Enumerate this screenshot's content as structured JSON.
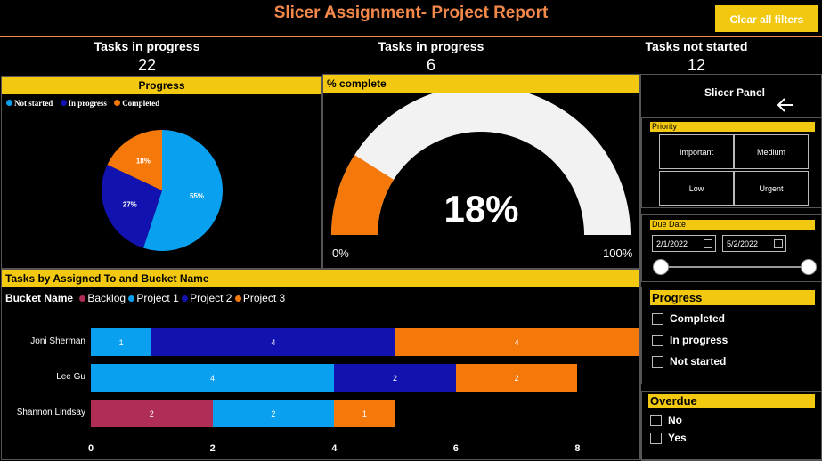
{
  "header": {
    "title": "Slicer Assignment- Project Report",
    "clear_button": "Clear all filters"
  },
  "kpis": [
    {
      "label": "Tasks in progress",
      "value": "22"
    },
    {
      "label": "Tasks in progress",
      "value": "6"
    },
    {
      "label": "Tasks not started",
      "value": "12"
    }
  ],
  "progress_panel": {
    "title": "Progress",
    "legend": [
      {
        "label": "Not started",
        "color": "#0aa0f0"
      },
      {
        "label": "In progress",
        "color": "#1212b0"
      },
      {
        "label": "Completed",
        "color": "#f5780a"
      }
    ]
  },
  "gauge_panel": {
    "title": "% complete",
    "value_label": "18%",
    "min_label": "0%",
    "max_label": "100%"
  },
  "bar_panel": {
    "title": "Tasks by Assigned To and Bucket Name",
    "legend_title": "Bucket Name",
    "legend": [
      {
        "label": "Backlog",
        "color": "#b02d55"
      },
      {
        "label": "Project 1",
        "color": "#0aa0f0"
      },
      {
        "label": "Project 2",
        "color": "#1212b0"
      },
      {
        "label": "Project 3",
        "color": "#f5780a"
      }
    ]
  },
  "slicer_panel": {
    "title": "Slicer Panel",
    "priority": {
      "title": "Priority",
      "options": [
        "Important",
        "Medium",
        "Low",
        "Urgent"
      ]
    },
    "due_date": {
      "title": "Due Date",
      "start": "2/1/2022",
      "end": "5/2/2022"
    },
    "progress": {
      "title": "Progress",
      "options": [
        "Completed",
        "In progress",
        "Not started"
      ]
    },
    "overdue": {
      "title": "Overdue",
      "options": [
        "No",
        "Yes"
      ]
    }
  },
  "chart_data": [
    {
      "type": "pie",
      "title": "Progress",
      "categories": [
        "Not started",
        "In progress",
        "Completed"
      ],
      "values": [
        55,
        27,
        18
      ],
      "labels": [
        "55%",
        "27%",
        "18%"
      ],
      "colors": [
        "#0aa0f0",
        "#1212b0",
        "#f5780a"
      ],
      "legend_position": "top-left"
    },
    {
      "type": "gauge",
      "title": "% complete",
      "value": 18,
      "min": 0,
      "max": 100
    },
    {
      "type": "bar",
      "orientation": "horizontal",
      "stacked": true,
      "title": "Tasks by Assigned To and Bucket Name",
      "categories": [
        "Joni Sherman",
        "Lee Gu",
        "Shannon Lindsay"
      ],
      "series": [
        {
          "name": "Backlog",
          "color": "#b02d55",
          "values": [
            0,
            0,
            2
          ]
        },
        {
          "name": "Project 1",
          "color": "#0aa0f0",
          "values": [
            1,
            4,
            2
          ]
        },
        {
          "name": "Project 2",
          "color": "#1212b0",
          "values": [
            4,
            2,
            0
          ]
        },
        {
          "name": "Project 3",
          "color": "#f5780a",
          "values": [
            4,
            2,
            1
          ]
        }
      ],
      "x_ticks": [
        "0",
        "2",
        "4",
        "6",
        "8"
      ],
      "xlim": [
        0,
        9
      ]
    }
  ]
}
